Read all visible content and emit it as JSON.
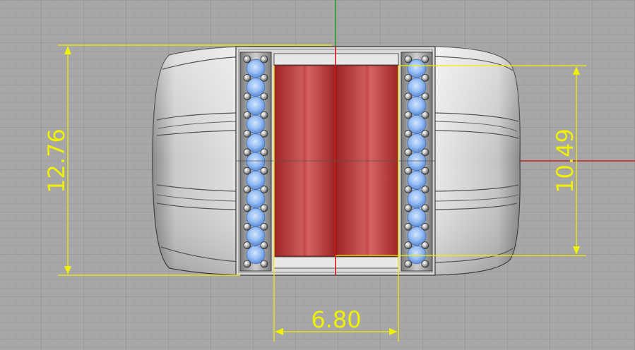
{
  "viewport": {
    "background": "#a6a6a6",
    "grid_color": "#9a9a9a",
    "grid_major_color": "#8f8f8f",
    "axis_x_color": "#c02020",
    "axis_y_color": "#1e9a1e"
  },
  "colors": {
    "dimension": "#f0f000",
    "metal_light": "#e6e6e6",
    "metal_mid": "#bdbdbd",
    "metal_dark": "#555555",
    "gem_blue": "#8fb8f2",
    "inlay_red": "#b83636"
  },
  "dimensions": {
    "overall_height": "12.76",
    "inlay_height": "10.49",
    "inlay_width": "6.80"
  }
}
